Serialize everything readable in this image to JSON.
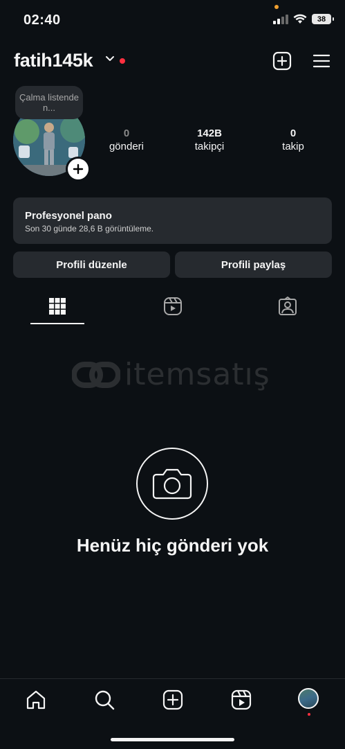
{
  "status_bar": {
    "time": "02:40",
    "battery": "38"
  },
  "header": {
    "username": "fatih145k"
  },
  "note": {
    "text": "Çalma listende n..."
  },
  "stats": [
    {
      "value": "0",
      "label": "gönderi"
    },
    {
      "value": "142B",
      "label": "takipçi"
    },
    {
      "value": "0",
      "label": "takip"
    }
  ],
  "professional": {
    "title": "Profesyonel pano",
    "subtitle": "Son 30 günde 28,6 B görüntüleme."
  },
  "buttons": {
    "edit": "Profili düzenle",
    "share": "Profili paylaş"
  },
  "empty_state": {
    "title": "Henüz hiç gönderi yok"
  },
  "watermark": {
    "text": "itemsatış"
  },
  "icons": {
    "header": [
      "new-post-icon",
      "menu-icon"
    ],
    "tabs": [
      "grid-icon",
      "reels-icon",
      "tagged-icon"
    ],
    "nav": [
      "home-icon",
      "search-icon",
      "create-icon",
      "reels-icon",
      "profile-avatar"
    ]
  },
  "colors": {
    "background": "#0c1014",
    "card": "#262a2f",
    "notification": "#ff3040"
  }
}
